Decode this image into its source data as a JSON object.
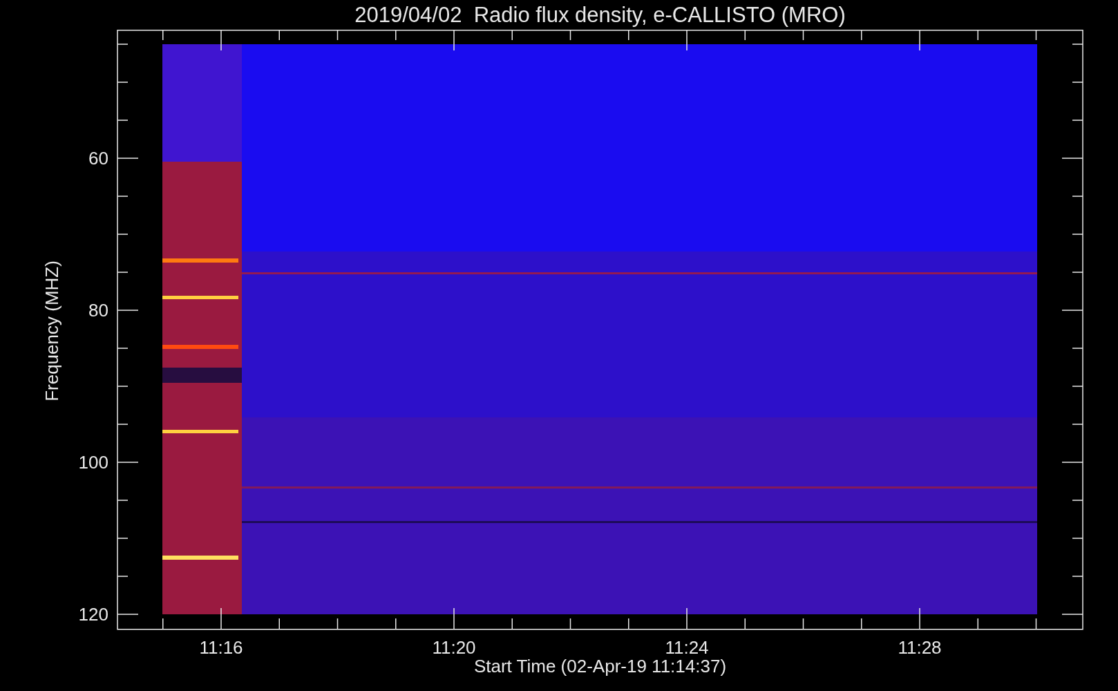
{
  "title": "2019/04/02  Radio flux density, e-CALLISTO (MRO)",
  "y_axis": {
    "label": "Frequency (MHZ)",
    "ticks": [
      "60",
      "80",
      "100",
      "120"
    ]
  },
  "x_axis": {
    "label": "Start Time (02-Apr-19 11:14:37)",
    "ticks": [
      "11:16",
      "11:20",
      "11:24",
      "11:28"
    ]
  }
}
